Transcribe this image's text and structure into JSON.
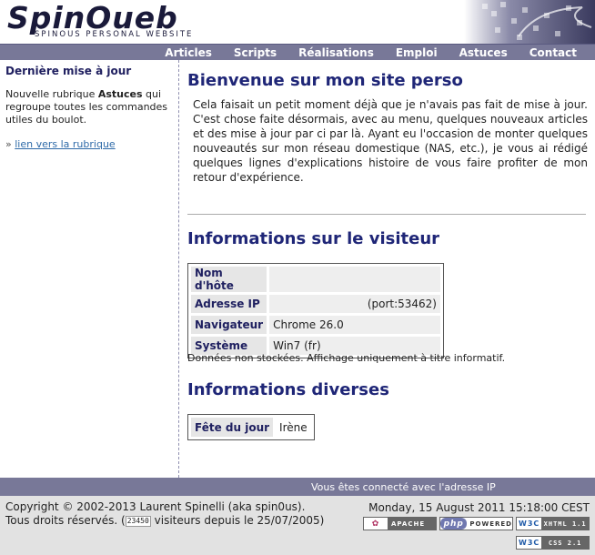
{
  "header": {
    "logo_text": "SpinOueb",
    "logo_subtitle": "SPINOUS PERSONAL WEBSITE"
  },
  "menu": {
    "items": [
      {
        "label": "Articles"
      },
      {
        "label": "Scripts"
      },
      {
        "label": "Réalisations"
      },
      {
        "label": "Emploi"
      },
      {
        "label": "Astuces"
      },
      {
        "label": "Contact"
      }
    ]
  },
  "sidebar": {
    "title": "Dernière mise à jour",
    "text_before": "Nouvelle rubrique ",
    "text_strong": "Astuces",
    "text_after": " qui regroupe toutes les commandes utiles du boulot.",
    "link_prefix": "»",
    "link_label": "lien vers la rubrique"
  },
  "main": {
    "welcome_title": "Bienvenue sur mon site perso",
    "intro": "Cela faisait un petit moment déjà que je n'avais pas fait de mise à jour. C'est chose faite désormais, avec au menu, quelques nouveaux articles et des mise à jour par ci par là. Ayant eu l'occasion de monter quelques nouveautés sur mon réseau domestique (NAS, etc.), je vous ai rédigé quelques lignes d'explications histoire de vous faire profiter de mon retour d'expérience.",
    "visitor_title": "Informations sur le visiteur",
    "visitor_rows": [
      {
        "label": "Nom d'hôte",
        "value": ""
      },
      {
        "label": "Adresse IP",
        "value": "(port:53462)"
      },
      {
        "label": "Navigateur",
        "value": "Chrome 26.0"
      },
      {
        "label": "Système",
        "value": "Win7 (fr)"
      }
    ],
    "visitor_note": "Données non stockées. Affichage uniquement à titre informatif.",
    "misc_title": "Informations diverses",
    "misc_rows": [
      {
        "label": "Fête du jour",
        "value": "Irène"
      }
    ]
  },
  "status_bar": {
    "text": "Vous êtes connecté avec l'adresse IP"
  },
  "footer": {
    "copyright_line": "Copyright © 2002-2013 Laurent Spinelli (aka spin0us).",
    "rights_prefix": "Tous droits réservés.",
    "counter": "23450",
    "rights_suffix": "visiteurs depuis le 25/07/2005)",
    "datetime": "Monday, 15 August 2011 15:18:00 CEST",
    "badges": {
      "apache": "APACHE",
      "php_logo": "php",
      "php": "POWERED",
      "w3c": "W3C",
      "xhtml": "XHTML 1.1",
      "css": "CSS 2.1"
    }
  },
  "colors": {
    "nav_bar": "#787898",
    "heading": "#1f2677",
    "link": "#2e6aa8",
    "footer_bg": "#e2e2e2"
  }
}
